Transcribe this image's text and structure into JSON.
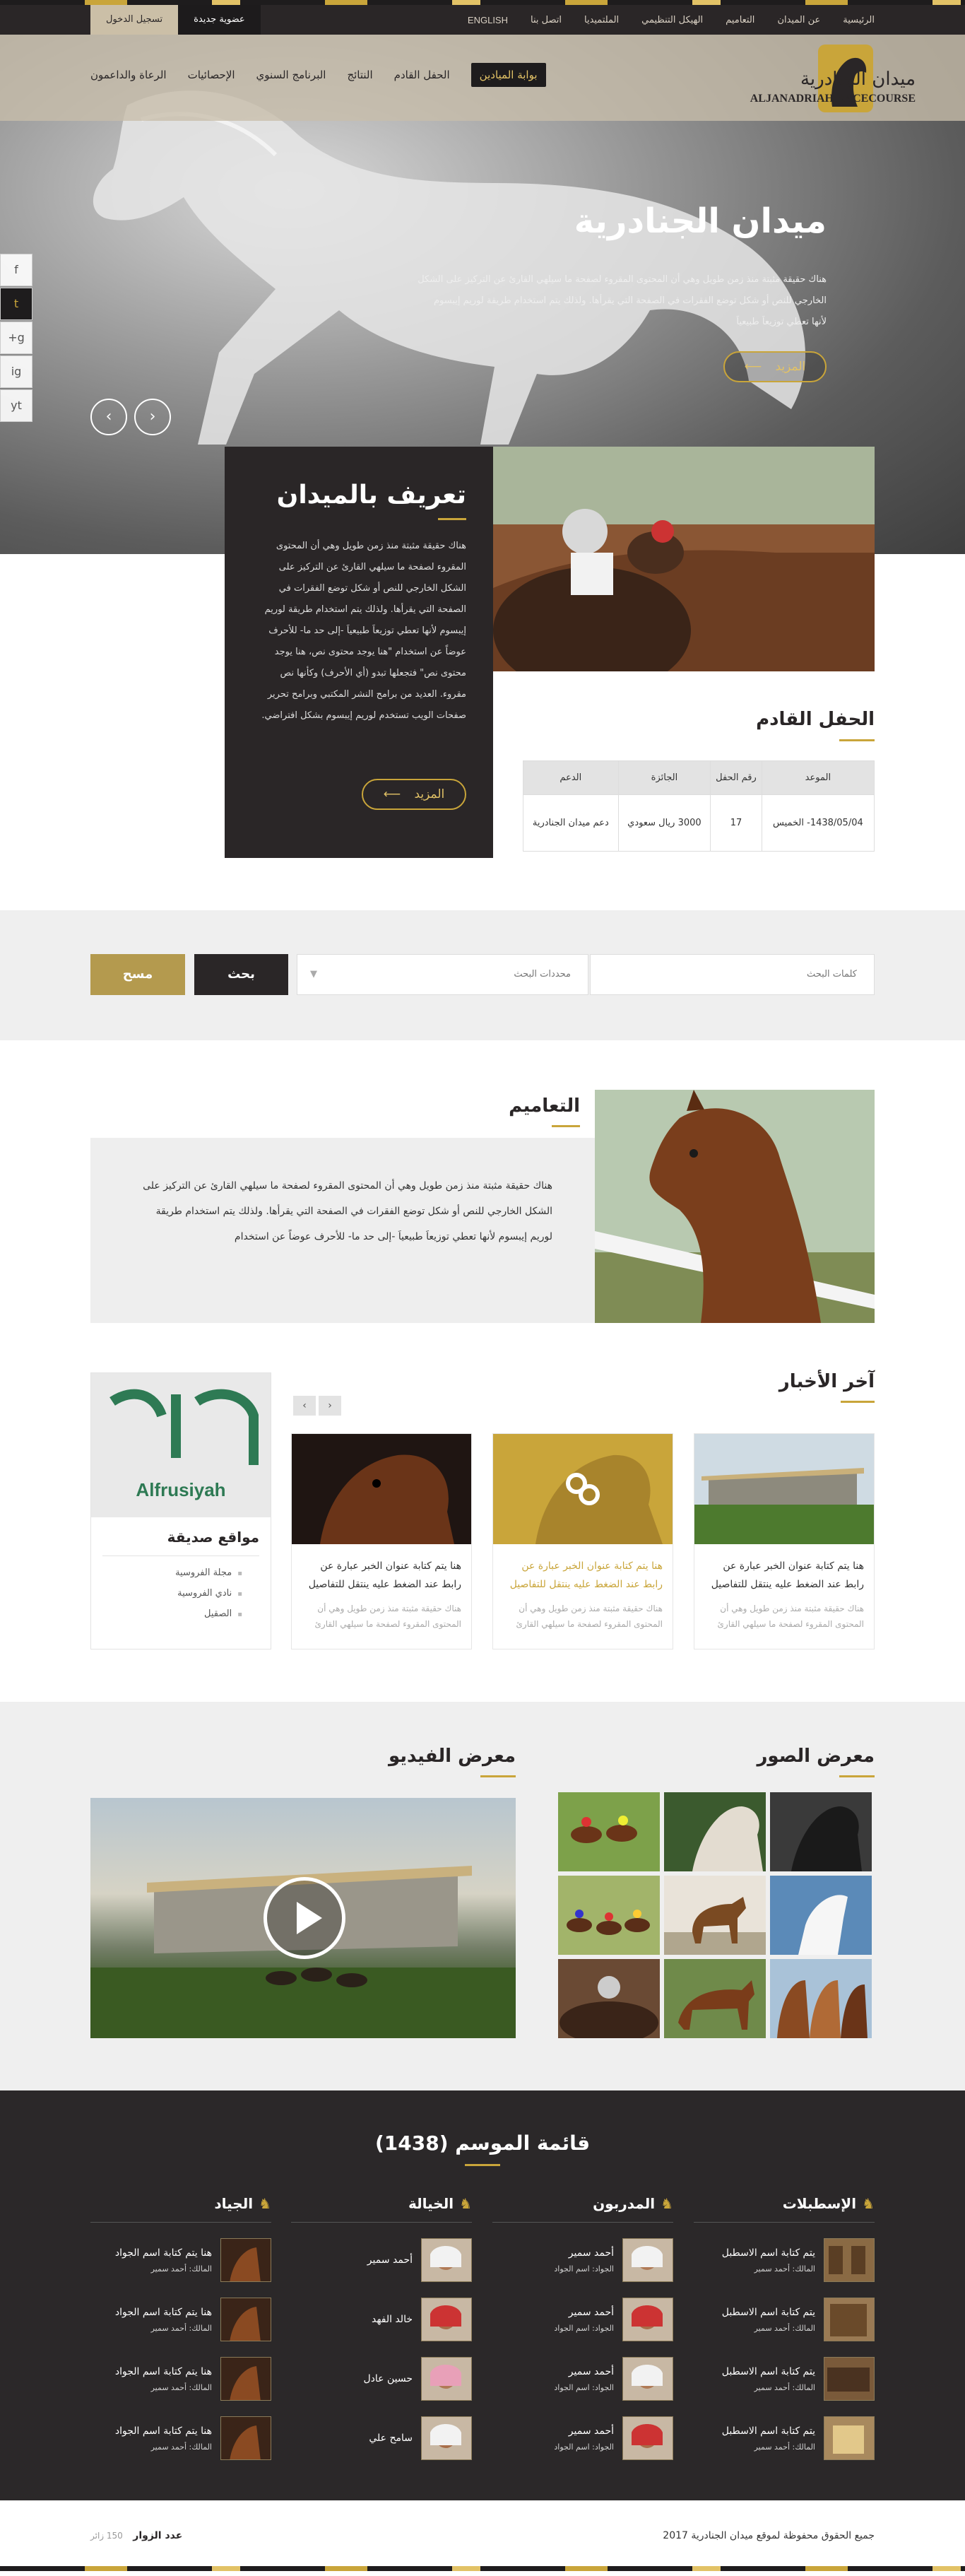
{
  "topbar": {
    "nav": [
      "الرئيسية",
      "عن الميدان",
      "التعاميم",
      "الهيكل التنظيمي",
      "الملتميديا",
      "اتصل بنا",
      "ENGLISH"
    ],
    "login": "تسجيل الدخول",
    "membership": "عضوية جديدة"
  },
  "header": {
    "logo_ar": "ميدان الجنادرية",
    "logo_en": "ALJANADRIAH RACECOURSE",
    "nav": [
      "بوابة الميادين",
      "الحفل القادم",
      "النتائج",
      "البرنامج السنوي",
      "الإحصائيات",
      "الرعاة والداعمون"
    ]
  },
  "hero": {
    "title": "ميدان الجنادرية",
    "text": "هناك حقيقة مثبتة منذ زمن طويل وهي أن المحتوى المقروء لصفحة ما سيلهي القارئ عن التركيز على الشكل الخارجي للنص أو شكل توضع الفقرات في الصفحة التي يقرأها. ولذلك يتم استخدام طريقة لوريم إيبسوم لأنها تعطي توزيعاَ طبيعياَ",
    "more": "المزيد"
  },
  "social": [
    "f",
    "t",
    "g+",
    "ig",
    "yt"
  ],
  "about": {
    "title": "تعريف بالميدان",
    "text": "هناك حقيقة مثبتة منذ زمن طويل وهي أن المحتوى المقروء لصفحة ما سيلهي القارئ عن التركيز على الشكل الخارجي للنص أو شكل توضع الفقرات في الصفحة التي يقرأها. ولذلك يتم استخدام طريقة لوريم إيبسوم لأنها تعطي توزيعاَ طبيعياَ -إلى حد ما- للأحرف عوضاً عن استخدام \"هنا يوجد محتوى نص، هنا يوجد محتوى نص\" فتجعلها تبدو (أي الأحرف) وكأنها نص مقروء. العديد من برامح النشر المكتبي وبرامح تحرير صفحات الويب تستخدم لوريم إيبسوم بشكل افتراضي.",
    "more": "المزيد"
  },
  "upcoming": {
    "title": "الحفل القادم",
    "headers": [
      "الموعد",
      "رقم الحفل",
      "الجائزة",
      "الدعم"
    ],
    "row": [
      "1438/05/04- الخميس",
      "17",
      "3000 ريال سعودي",
      "دعم ميدان الجنادرية"
    ]
  },
  "search": {
    "keywords_placeholder": "كلمات البحث",
    "filter_placeholder": "محددات البحث",
    "search_label": "بحث",
    "clear_label": "مسح"
  },
  "circulars": {
    "title": "التعاميم",
    "text": "هناك حقيقة مثبتة منذ زمن طويل وهي أن المحتوى المقروء لصفحة ما سيلهي القارئ عن التركيز على الشكل الخارجي للنص أو شكل توضع الفقرات في الصفحة التي يقرأها. ولذلك يتم استخدام طريقة لوريم إيبسوم لأنها تعطي توزيعاَ طبيعياَ -إلى حد ما- للأحرف عوضاً عن استخدام"
  },
  "news": {
    "title": "آخر الأخبار",
    "items": [
      {
        "title": "هنا يتم كتابة عنوان الخبر عبارة عن رابط عند الضغط عليه ينتقل للتفاصيل",
        "text": "هناك حقيقة مثبتة منذ زمن طويل وهي أن المحتوى المقروء لصفحة ما سيلهي القارئ"
      },
      {
        "title": "هنا يتم كتابة عنوان الخبر عبارة عن رابط عند الضغط عليه ينتقل للتفاصيل",
        "text": "هناك حقيقة مثبتة منذ زمن طويل وهي أن المحتوى المقروء لصفحة ما سيلهي القارئ"
      },
      {
        "title": "هنا يتم كتابة عنوان الخبر عبارة عن رابط عند الضغط عليه ينتقل للتفاصيل",
        "text": "هناك حقيقة مثبتة منذ زمن طويل وهي أن المحتوى المقروء لصفحة ما سيلهي القارئ"
      }
    ]
  },
  "friends": {
    "logo_text": "Alfrusiyah",
    "title": "مواقع صديقة",
    "items": [
      "مجلة الفروسية",
      "نادي الفروسية",
      "الصقيل"
    ]
  },
  "media": {
    "gallery_title": "معرض الصور",
    "video_title": "معرض الفيديو"
  },
  "season": {
    "title": "قائمة الموسم (1438)",
    "columns": [
      {
        "title": "الإسطبلات",
        "rows": [
          {
            "name": "يتم كتابة اسم الاسطبل",
            "sub": "المالك: أحمد سمير"
          },
          {
            "name": "يتم كتابة اسم الاسطبل",
            "sub": "المالك: أحمد سمير"
          },
          {
            "name": "يتم كتابة اسم الاسطبل",
            "sub": "المالك: أحمد سمير"
          },
          {
            "name": "يتم كتابة اسم الاسطبل",
            "sub": "المالك: أحمد سمير"
          }
        ]
      },
      {
        "title": "المدربون",
        "rows": [
          {
            "name": "أحمد سمير",
            "sub": "الجواد: اسم الجواد"
          },
          {
            "name": "أحمد سمير",
            "sub": "الجواد: اسم الجواد"
          },
          {
            "name": "أحمد سمير",
            "sub": "الجواد: اسم الجواد"
          },
          {
            "name": "أحمد سمير",
            "sub": "الجواد: اسم الجواد"
          }
        ]
      },
      {
        "title": "الخيالة",
        "rows": [
          {
            "name": "أحمد سمير",
            "sub": ""
          },
          {
            "name": "خالد الفهد",
            "sub": ""
          },
          {
            "name": "حسين عادل",
            "sub": ""
          },
          {
            "name": "سامح علي",
            "sub": ""
          }
        ]
      },
      {
        "title": "الجياد",
        "rows": [
          {
            "name": "هنا يتم كتابة اسم الجواد",
            "sub": "المالك: أحمد سمير"
          },
          {
            "name": "هنا يتم كتابة اسم الجواد",
            "sub": "المالك: أحمد سمير"
          },
          {
            "name": "هنا يتم كتابة اسم الجواد",
            "sub": "المالك: أحمد سمير"
          },
          {
            "name": "هنا يتم كتابة اسم الجواد",
            "sub": "المالك: أحمد سمير"
          }
        ]
      }
    ]
  },
  "footer": {
    "copyright": "جميع الحقوق محفوظة لموقع ميدان الجنادرية 2017",
    "visits_label": "عدد الزوار",
    "visits_value": "150 زائر"
  },
  "colors": {
    "gold": "#c9a53a",
    "dark": "#2a2627",
    "light": "#efefef"
  }
}
